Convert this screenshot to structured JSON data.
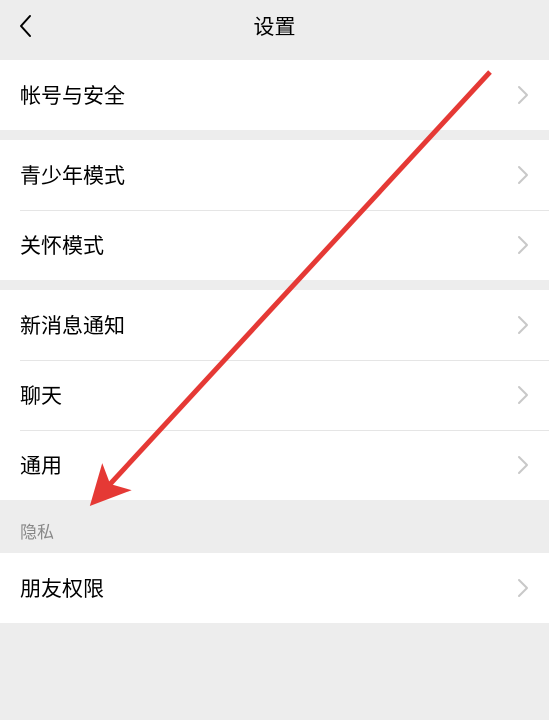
{
  "header": {
    "title": "设置"
  },
  "groups": {
    "g1": {
      "items": [
        {
          "label": "帐号与安全"
        }
      ]
    },
    "g2": {
      "items": [
        {
          "label": "青少年模式"
        },
        {
          "label": "关怀模式"
        }
      ]
    },
    "g3": {
      "items": [
        {
          "label": "新消息通知"
        },
        {
          "label": "聊天"
        },
        {
          "label": "通用"
        }
      ]
    },
    "g4": {
      "header": "隐私",
      "items": [
        {
          "label": "朋友权限"
        }
      ]
    }
  },
  "annotation": {
    "arrow_color": "#e53935"
  }
}
